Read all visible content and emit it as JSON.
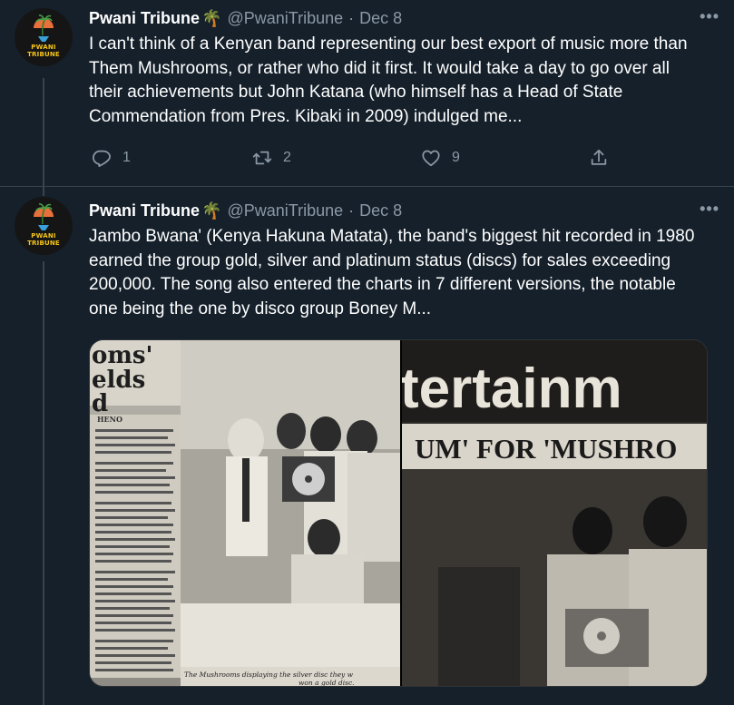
{
  "tweets": [
    {
      "author_name": "Pwani Tribune",
      "author_emoji": "🌴",
      "handle": "@PwaniTribune",
      "separator": "·",
      "date": "Dec 8",
      "avatar_text": "PWANI TRIBUNE",
      "more": "•••",
      "text": "I can't think of a Kenyan band representing our best export of music more than Them Mushrooms, or rather who did it first. It would take a day to go over all their achievements but John Katana (who himself has a Head of State Commendation from Pres. Kibaki in 2009) indulged me...",
      "reply_count": "1",
      "retweet_count": "2",
      "like_count": "9"
    },
    {
      "author_name": "Pwani Tribune",
      "author_emoji": "🌴",
      "handle": "@PwaniTribune",
      "separator": "·",
      "date": "Dec 8",
      "avatar_text": "PWANI TRIBUNE",
      "more": "•••",
      "text": "Jambo Bwana' (Kenya Hakuna Matata), the band's biggest hit recorded in 1980 earned the group gold, silver and platinum status (discs) for sales exceeding 200,000. The song also entered the charts in 7 different versions, the notable one being the one by disco group Boney M..."
    }
  ],
  "media": {
    "left_headline": "ooms' elds d",
    "left_byline": "HENO",
    "left_caption": "The Mushrooms displaying the silver disc they w won a gold disc.",
    "right_headline": "tertainm",
    "right_subheadline": "UM' FOR 'MUSHRO"
  },
  "icons": {
    "reply": "reply-icon",
    "retweet": "retweet-icon",
    "like": "like-icon",
    "share": "share-icon"
  },
  "colors": {
    "background": "#15202b",
    "divider": "#38444d",
    "secondary_text": "#8b98a5",
    "primary_text": "#ffffff"
  }
}
